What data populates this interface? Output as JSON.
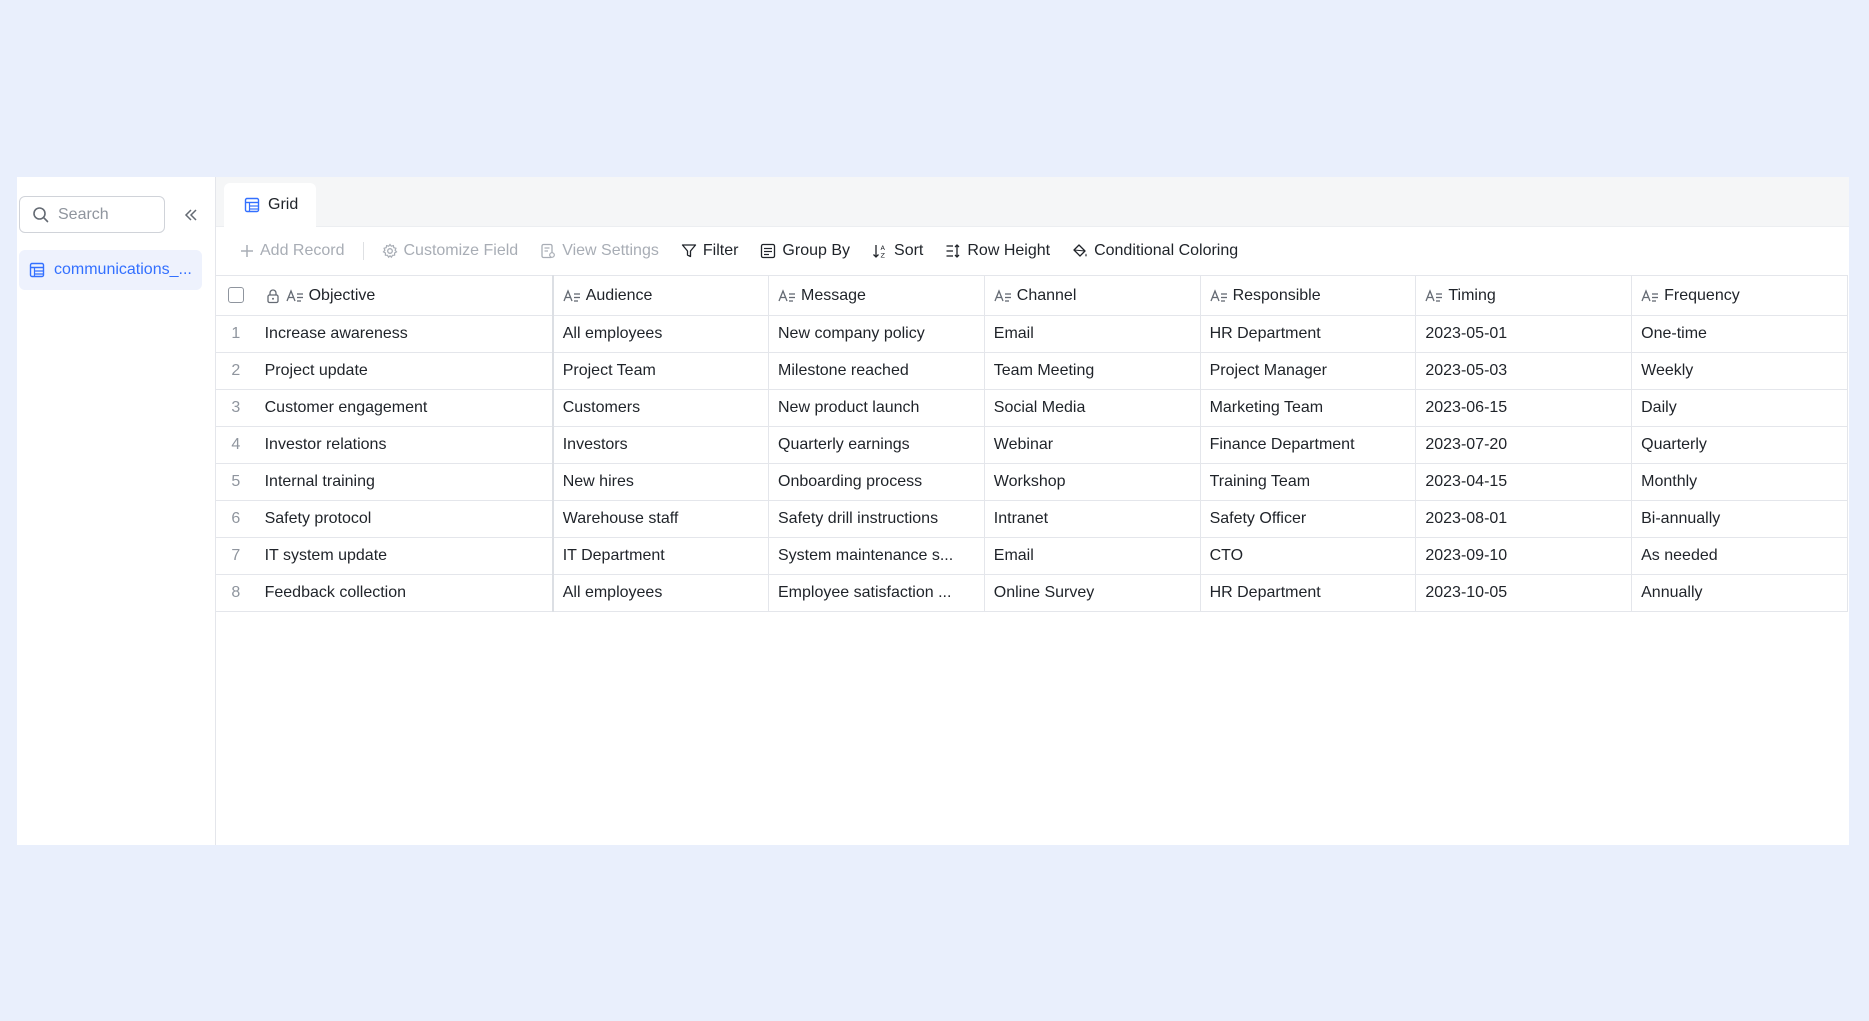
{
  "sidebar": {
    "search_placeholder": "Search",
    "table_name": "communications_..."
  },
  "tabs": [
    {
      "label": "Grid"
    }
  ],
  "toolbar": {
    "add_record": "Add Record",
    "customize_field": "Customize Field",
    "view_settings": "View Settings",
    "filter": "Filter",
    "group_by": "Group By",
    "sort": "Sort",
    "row_height": "Row Height",
    "conditional_coloring": "Conditional Coloring"
  },
  "table": {
    "columns": [
      "Objective",
      "Audience",
      "Message",
      "Channel",
      "Responsible",
      "Timing",
      "Frequency"
    ],
    "rows": [
      {
        "num": "1",
        "cells": [
          "Increase awareness",
          "All employees",
          "New company policy",
          "Email",
          "HR Department",
          "2023-05-01",
          "One-time"
        ]
      },
      {
        "num": "2",
        "cells": [
          "Project update",
          "Project Team",
          "Milestone reached",
          "Team Meeting",
          "Project Manager",
          "2023-05-03",
          "Weekly"
        ]
      },
      {
        "num": "3",
        "cells": [
          "Customer engagement",
          "Customers",
          "New product launch",
          "Social Media",
          "Marketing Team",
          "2023-06-15",
          "Daily"
        ]
      },
      {
        "num": "4",
        "cells": [
          "Investor relations",
          "Investors",
          "Quarterly earnings",
          "Webinar",
          "Finance Department",
          "2023-07-20",
          "Quarterly"
        ]
      },
      {
        "num": "5",
        "cells": [
          "Internal training",
          "New hires",
          "Onboarding process",
          "Workshop",
          "Training Team",
          "2023-04-15",
          "Monthly"
        ]
      },
      {
        "num": "6",
        "cells": [
          "Safety protocol",
          "Warehouse staff",
          "Safety drill instructions",
          "Intranet",
          "Safety Officer",
          "2023-08-01",
          "Bi-annually"
        ]
      },
      {
        "num": "7",
        "cells": [
          "IT system update",
          "IT Department",
          "System maintenance s...",
          "Email",
          "CTO",
          "2023-09-10",
          "As needed"
        ]
      },
      {
        "num": "8",
        "cells": [
          "Feedback collection",
          "All employees",
          "Employee satisfaction ...",
          "Online Survey",
          "HR Department",
          "2023-10-05",
          "Annually"
        ]
      }
    ]
  }
}
